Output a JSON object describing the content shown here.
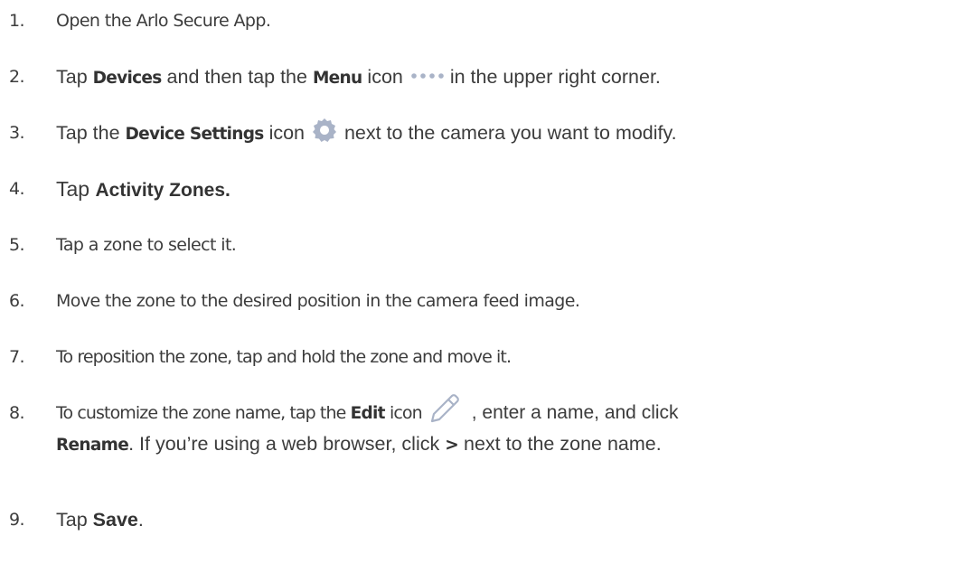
{
  "steps": [
    {
      "num": "1.",
      "text": "Open the Arlo Secure App."
    },
    {
      "num": "2.",
      "pre": "Tap ",
      "bold1": "Devices",
      "mid": " and then tap the ",
      "bold2": "Menu",
      "post1": " icon",
      "post2": " in the  upper right corner.",
      "icon": "ellipsis-menu-icon"
    },
    {
      "num": "3.",
      "pre": "Tap the ",
      "bold": "Device Settings",
      "post1": " icon",
      "post2": " next to the camera you want to modify.",
      "icon": "gear-icon"
    },
    {
      "num": "4.",
      "pre": "Tap ",
      "bold": "Activity Zones."
    },
    {
      "num": "5.",
      "text": "Tap a zone to select it."
    },
    {
      "num": "6.",
      "text": "Move the zone to the desired position in the camera feed image."
    },
    {
      "num": "7.",
      "text": "To reposition the zone, tap and hold the zone and move it."
    },
    {
      "num": "8.",
      "pre": "To customize the zone name, tap the ",
      "bold": "Edit",
      "post1": " icon",
      "post2": " , enter a name, and click",
      "line2_bold": "Rename",
      "line2_mid": ". If you’re using a web browser, click ",
      "line2_bold2": ">",
      "line2_post": " next to the zone name.",
      "icon": "pencil-icon"
    },
    {
      "num": "9.",
      "pre": "Tap ",
      "bold": "Save",
      "post": "."
    }
  ],
  "colors": {
    "text": "#3c3c3c",
    "icon": "#a9b3c7"
  }
}
